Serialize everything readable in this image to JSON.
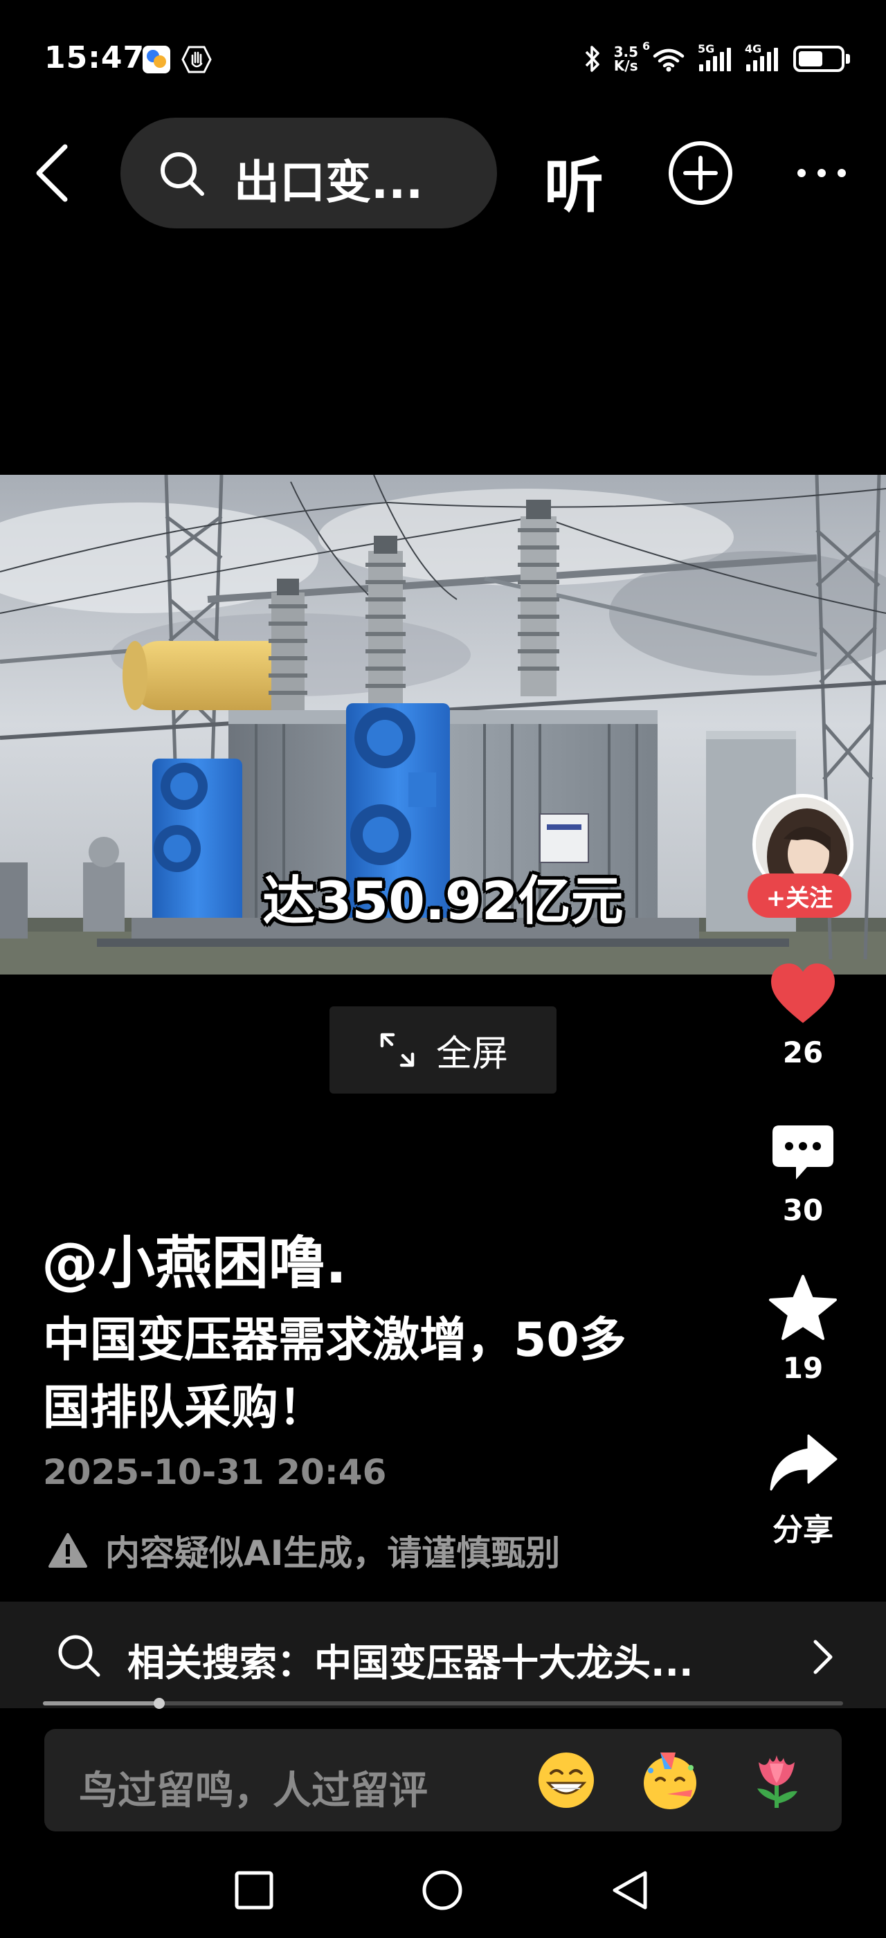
{
  "status_bar": {
    "time": "15:47",
    "net_speed_top": "3.5",
    "net_speed_bottom": "K/s",
    "sim1_tag": "5G",
    "sim2_tag": "4G",
    "wifi_tag": "6"
  },
  "nav": {
    "search_text": "出口变...",
    "listen_label": "听"
  },
  "video": {
    "subtitle": "达350.92亿元",
    "fullscreen_label": "全屏"
  },
  "rail": {
    "follow_label": "+关注",
    "likes": "26",
    "comments": "30",
    "favorites": "19",
    "share_label": "分享",
    "like_color": "#e9454a"
  },
  "post": {
    "author": "@小燕困噜.",
    "title": "中国变压器需求激增，50多国排队采购！",
    "date": "2025-10-31 20:46",
    "ai_notice": "内容疑似AI生成，请谨慎甄别"
  },
  "related": {
    "label": "相关搜索：中国变压器十大龙头..."
  },
  "progress": {
    "value": 0.145
  },
  "comment": {
    "placeholder": "鸟过留鸣，人过留评",
    "emojis": [
      "grinning-face-icon",
      "partying-face-icon",
      "tulip-icon"
    ]
  }
}
